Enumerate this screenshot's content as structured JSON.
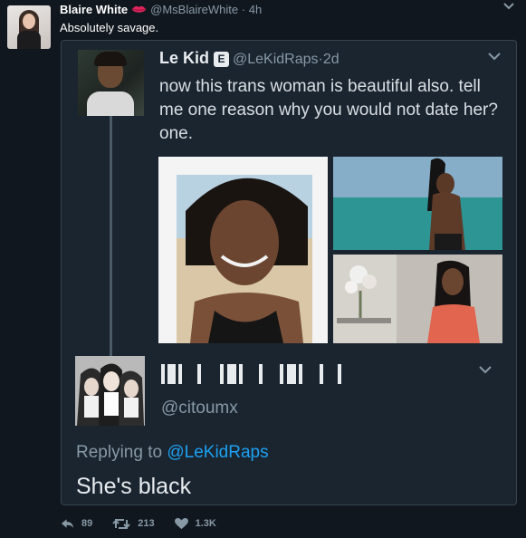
{
  "tweet": {
    "author_name": "Blaire White",
    "author_handle": "@MsBlaireWhite",
    "separator": "·",
    "time": "4h",
    "text": "Absolutely savage.",
    "icons": {
      "author_emoji": "lips-icon",
      "menu": "chevron-down-icon"
    }
  },
  "quoted_tweet": {
    "author_name": "Le Kid",
    "badge": "E",
    "author_handle": "@LeKidRaps",
    "separator": "·",
    "time": "2d",
    "text": "now this trans woman is beautiful also. tell me one reason why you would not date her? one.",
    "images": [
      "photo-1",
      "photo-2",
      "photo-3"
    ]
  },
  "reply_tweet": {
    "author_name_glyphs": "▌█▌ ▌ ▌█▌ ▌ ▌█▌ ▌ ▌",
    "author_handle": "@citoumx",
    "replying_label": "Replying to",
    "replying_to": "@LeKidRaps",
    "text": "She's black"
  },
  "actions": {
    "replies": "89",
    "retweets": "213",
    "likes": "1.3K",
    "icons": [
      "reply-icon",
      "retweet-icon",
      "heart-icon"
    ]
  },
  "colors": {
    "background": "#10171e",
    "card": "#1a2530",
    "muted": "#8899a6",
    "link": "#1da1f2",
    "lips": "#e0245e"
  }
}
